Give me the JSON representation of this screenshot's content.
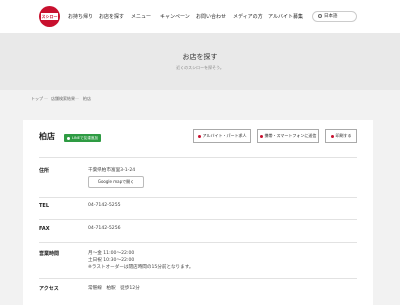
{
  "header": {
    "logo_text": "スシロー",
    "nav": [
      "お持ち帰り",
      "お店を探す",
      "メニュー",
      "キャンペーン",
      "お問い合わせ",
      "メディアの方",
      "アルバイト募集"
    ],
    "lang": "日本語"
  },
  "hero": {
    "title": "お店を探す",
    "subtitle": "近くのスシローを探そう。"
  },
  "breadcrumb": [
    "トップ",
    "店舗検索結果",
    "柏店"
  ],
  "shop": {
    "name": "柏店",
    "line_badge": "LINEで友達追加",
    "buttons": [
      "アルバイト・パート求人",
      "携帯・スマートフォンに送信",
      "印刷する"
    ]
  },
  "details": {
    "address_label": "住所",
    "address": "千葉県柏市富里3-1-24",
    "map_button": "Google mapで開く",
    "tel_label": "TEL",
    "tel": "04-7142-5255",
    "fax_label": "FAX",
    "fax": "04-7142-5256",
    "hours_label": "営業時間",
    "hours": [
      "月～金 11:00～22:00",
      "土日祝 10:30～22:00",
      "※ラストオーダーは閉店時間の15分前となります。"
    ],
    "access_label": "アクセス",
    "access": "常磐線　柏駅　徒歩12分"
  }
}
